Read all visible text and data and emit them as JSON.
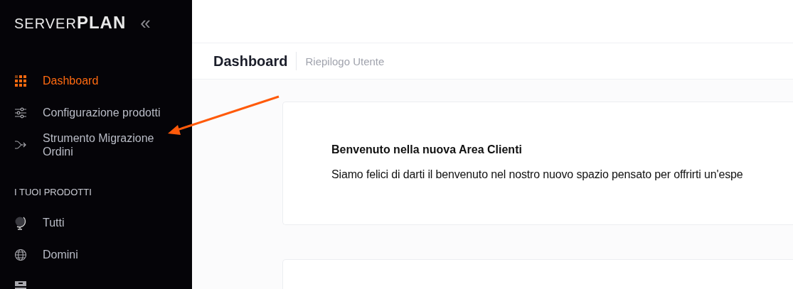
{
  "sidebar": {
    "logo": "SERVER**PLAN**",
    "collapse": "«",
    "items": [
      {
        "kind": "grid",
        "label": "Dashboard",
        "selected": true
      },
      {
        "kind": "sliders",
        "label": "Configurazione prodotti",
        "selected": false
      },
      {
        "kind": "merge",
        "label": "Strumento Migrazione Ordini",
        "selected": false
      }
    ],
    "section": {
      "title": "I TUOI PRODOTTI",
      "items": [
        {
          "kind": "globe",
          "label": "Tutti",
          "selected": false
        },
        {
          "kind": "web",
          "label": "Domini",
          "selected": false
        },
        {
          "kind": "server",
          "selected": false
        }
      ]
    }
  },
  "page_header": {
    "title": "Dashboard",
    "subtitle": "Riepilogo Utente"
  },
  "welcome_card": {
    "title": "Benvenuto nella nuova Area Clienti",
    "text": "Siamo felici di darti il benvenuto nel nostro nuovo spazio pensato per offrirti un'espe"
  }
}
